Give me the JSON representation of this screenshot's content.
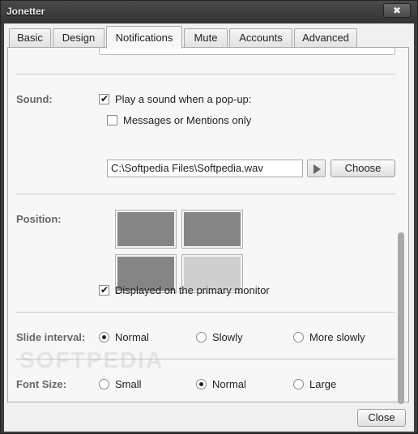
{
  "window": {
    "title": "Jonetter",
    "close_glyph": "✖"
  },
  "tabs": [
    {
      "label": "Basic",
      "active": false
    },
    {
      "label": "Design",
      "active": false
    },
    {
      "label": "Notifications",
      "active": true
    },
    {
      "label": "Mute",
      "active": false
    },
    {
      "label": "Accounts",
      "active": false
    },
    {
      "label": "Advanced",
      "active": false
    }
  ],
  "sound": {
    "label": "Sound:",
    "play_sound": {
      "label": "Play a sound when a pop-up:",
      "checked": true
    },
    "messages_only": {
      "label": "Messages or Mentions only",
      "checked": false
    },
    "file_path": "C:\\Softpedia Files\\Softpedia.wav",
    "choose_label": "Choose"
  },
  "position": {
    "label": "Position:",
    "selected_cell": "bottom-right",
    "primary_monitor": {
      "label": "Displayed on the primary monitor",
      "checked": true
    }
  },
  "slide_interval": {
    "label": "Slide interval:",
    "options": [
      "Normal",
      "Slowly",
      "More slowly"
    ],
    "selected": "Normal"
  },
  "font_size": {
    "label": "Font Size:",
    "options": [
      "Small",
      "Normal",
      "Large"
    ],
    "selected": "Normal"
  },
  "footer": {
    "close_label": "Close"
  },
  "watermark": "SOFTPEDIA",
  "check_glyph": "✔"
}
